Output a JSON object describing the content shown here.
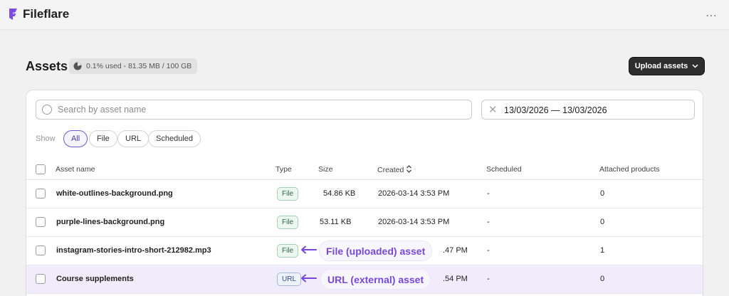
{
  "app": {
    "title": "Fileflare",
    "logo_icon": "fileflare-logo-icon",
    "more_icon": "⋯"
  },
  "colors": {
    "brand": "#7c4ce0",
    "accent": "#6b5bc7",
    "annotation": "#7747dc"
  },
  "header": {
    "title": "Assets",
    "storage": {
      "text": "0.1% used - 81.35 MB / 100 GB",
      "used_fraction": 0.001
    },
    "upload_button": "Upload assets"
  },
  "filters": {
    "search_placeholder": "Search by asset name",
    "search_value": "",
    "date_range": "13/03/2026 — 13/03/2026",
    "show_label": "Show",
    "chips": [
      {
        "label": "All",
        "active": true
      },
      {
        "label": "File",
        "active": false
      },
      {
        "label": "URL",
        "active": false
      },
      {
        "label": "Scheduled",
        "active": false
      }
    ]
  },
  "table": {
    "columns": [
      "Asset name",
      "Type",
      "Size",
      "Created",
      "Scheduled",
      "Attached products"
    ],
    "rows": [
      {
        "name": "white-outlines-background.png",
        "type": "File",
        "size": "54.86 KB",
        "created": "2026-03-14 3:53 PM",
        "scheduled": "-",
        "attached": "0"
      },
      {
        "name": "purple-lines-background.png",
        "type": "File",
        "size": "53.11 KB",
        "created": "2026-03-14 3:53 PM",
        "scheduled": "-",
        "attached": "0"
      },
      {
        "name": "instagram-stories-intro-short-212982.mp3",
        "type": "File",
        "size": "",
        "created": ".47 PM",
        "scheduled": "-",
        "attached": "1"
      },
      {
        "name": "Course supplements",
        "type": "URL",
        "size": "",
        "created": ".54 PM",
        "scheduled": "-",
        "attached": "0"
      }
    ]
  },
  "annotations": {
    "file": "File (uploaded) asset",
    "url": "URL (external) asset"
  }
}
